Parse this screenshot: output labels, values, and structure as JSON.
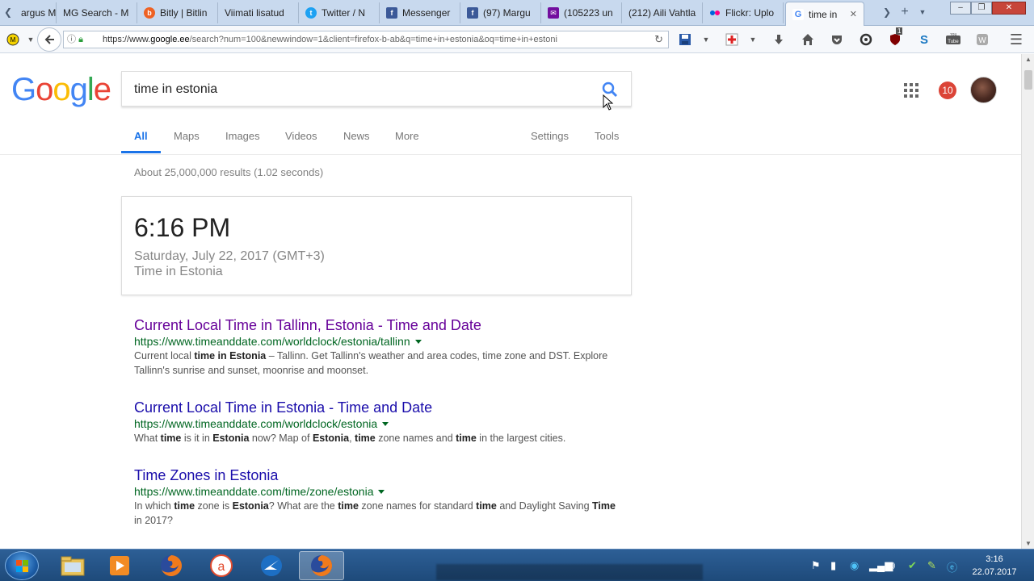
{
  "browser": {
    "tabs": [
      {
        "label": "argus M",
        "favicon": "muted"
      },
      {
        "label": "MG Search - M",
        "favicon": "none"
      },
      {
        "label": "Bitly | Bitlin",
        "favicon": "bitly"
      },
      {
        "label": "Viimati lisatud",
        "favicon": "none"
      },
      {
        "label": "Twitter / N",
        "favicon": "twitter"
      },
      {
        "label": "Messenger",
        "favicon": "facebook"
      },
      {
        "label": "(97) Margu",
        "favicon": "facebook"
      },
      {
        "label": "(105223 un",
        "favicon": "mail"
      },
      {
        "label": "(212) Aili Vahtla",
        "favicon": "none"
      },
      {
        "label": "Flickr: Uplo",
        "favicon": "flickr"
      },
      {
        "label": "time in",
        "favicon": "google",
        "active": true
      }
    ],
    "url": {
      "scheme": "https://www.",
      "host": "google.ee",
      "rest": "/search?num=100&newwindow=1&client=firefox-b-ab&q=time+in+estonia&oq=time+in+estoni"
    },
    "ublock_badge": "1"
  },
  "google": {
    "search_query": "time in estonia",
    "notification_count": "10",
    "tabs": [
      "All",
      "Maps",
      "Images",
      "Videos",
      "News",
      "More"
    ],
    "settings_label": "Settings",
    "tools_label": "Tools",
    "result_stats": "About 25,000,000 results (1.02 seconds)",
    "time_card": {
      "time": "6:16 PM",
      "date": "Saturday, July 22, 2017 (GMT+3)",
      "location": "Time in Estonia"
    },
    "results": [
      {
        "title": "Current Local Time in Tallinn, Estonia - Time and Date",
        "url": "https://www.timeanddate.com/worldclock/estonia/tallinn",
        "snippet_parts": [
          "Current local ",
          "time in Estonia",
          " – Tallinn. Get Tallinn's weather and area codes, time zone and DST. Explore Tallinn's sunrise and sunset, moonrise and moonset."
        ],
        "visited": true
      },
      {
        "title": "Current Local Time in Estonia - Time and Date",
        "url": "https://www.timeanddate.com/worldclock/estonia",
        "snippet_parts": [
          "What ",
          "time",
          " is it in ",
          "Estonia",
          " now? Map of ",
          "Estonia",
          ", ",
          "time",
          " zone names and ",
          "time",
          " in the largest cities."
        ],
        "visited": false
      },
      {
        "title": "Time Zones in Estonia",
        "url": "https://www.timeanddate.com/time/zone/estonia",
        "snippet_parts": [
          "In which ",
          "time",
          " zone is ",
          "Estonia",
          "? What are the ",
          "time",
          " zone names for standard ",
          "time",
          " and Daylight Saving ",
          "Time",
          " in 2017?"
        ],
        "visited": false
      }
    ]
  },
  "taskbar": {
    "time": "3:16",
    "date": "22.07.2017"
  },
  "colors": {
    "link": "#1a0dab",
    "visited": "#660099",
    "url_green": "#006621",
    "accent_blue": "#1a73e8",
    "badge_red": "#db4437"
  }
}
